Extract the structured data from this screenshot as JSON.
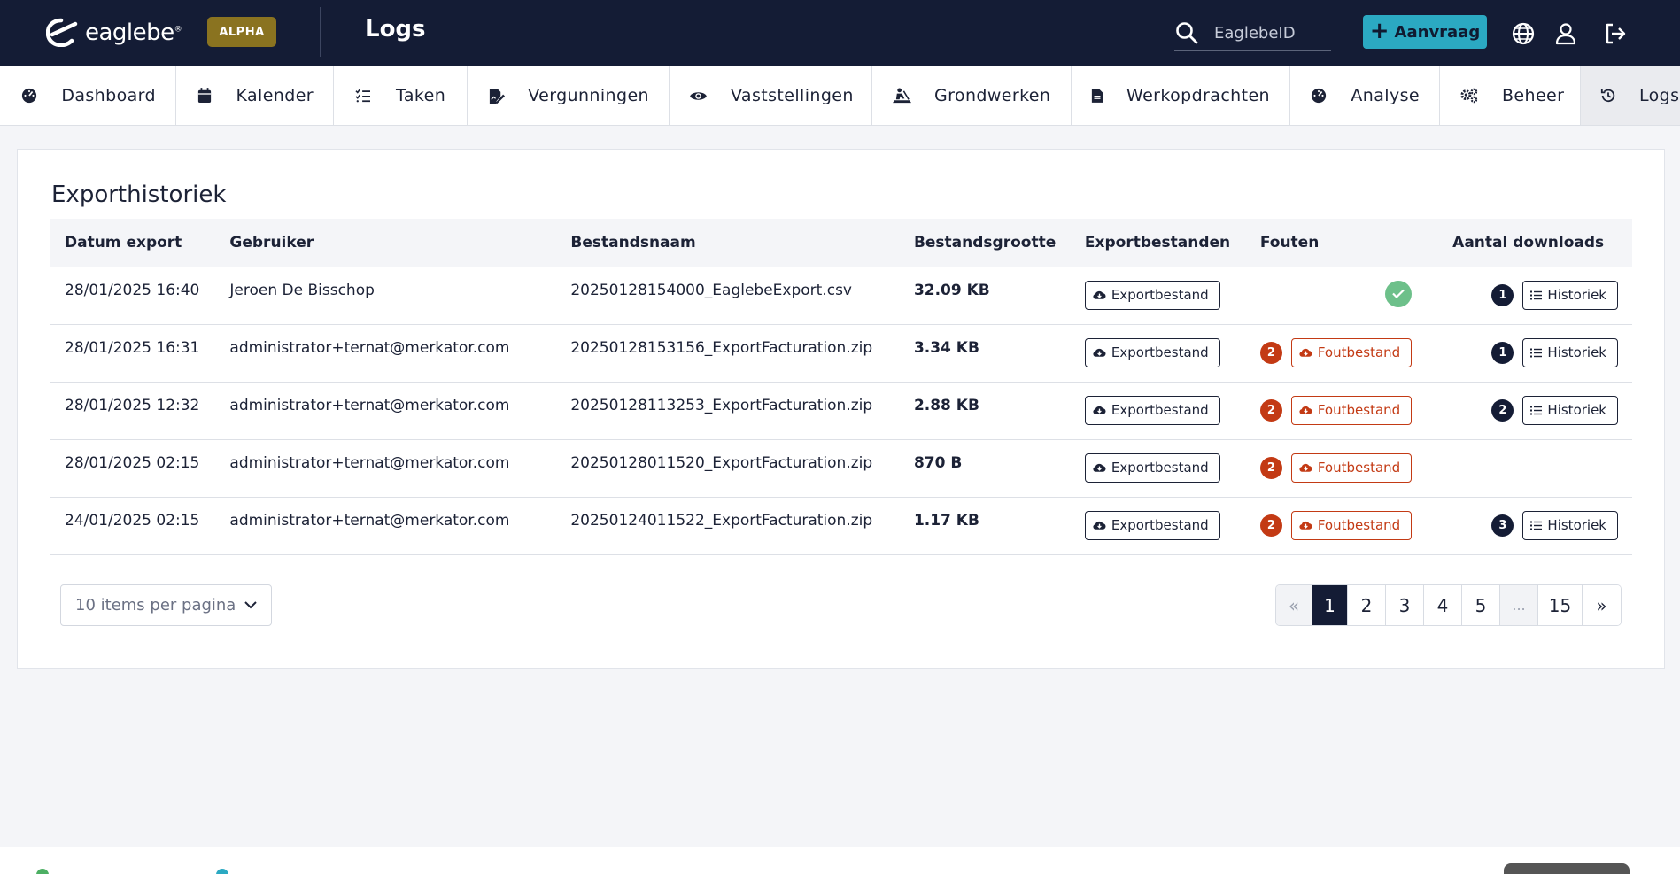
{
  "header": {
    "logo_text": "eaglebe",
    "logo_mark": "®",
    "alpha_badge": "ALPHA",
    "page_title": "Logs",
    "search_placeholder": "EaglebeID",
    "aanvraag_label": "Aanvraag",
    "icons": [
      "search-icon",
      "globe-icon",
      "user-icon",
      "logout-icon"
    ]
  },
  "nav": {
    "items": [
      {
        "label": "Dashboard",
        "icon": "dashboard-icon"
      },
      {
        "label": "Kalender",
        "icon": "calendar-icon"
      },
      {
        "label": "Taken",
        "icon": "tasks-icon"
      },
      {
        "label": "Vergunningen",
        "icon": "permit-icon"
      },
      {
        "label": "Vaststellingen",
        "icon": "eye-icon"
      },
      {
        "label": "Grondwerken",
        "icon": "digging-icon"
      },
      {
        "label": "Werkopdrachten",
        "icon": "document-icon"
      },
      {
        "label": "Analyse",
        "icon": "analysis-icon"
      },
      {
        "label": "Beheer",
        "icon": "gears-icon"
      },
      {
        "label": "Logs",
        "icon": "history-icon"
      }
    ],
    "active": "Logs"
  },
  "card": {
    "title": "Exporthistoriek",
    "columns": [
      "Datum export",
      "Gebruiker",
      "Bestandsnaam",
      "Bestandsgrootte",
      "Exportbestanden",
      "Fouten",
      "Aantal downloads"
    ],
    "export_button_label": "Exportbestand",
    "error_button_label": "Foutbestand",
    "history_button_label": "Historiek",
    "rows": [
      {
        "date": "28/01/2025 16:40",
        "user": "Jeroen De Bisschop",
        "file": "20250128154000_EaglebeExport.csv",
        "size": "32.09 KB",
        "errors": null,
        "downloads": "1"
      },
      {
        "date": "28/01/2025 16:31",
        "user": "administrator+ternat@merkator.com",
        "file": "20250128153156_ExportFacturation.zip",
        "size": "3.34 KB",
        "errors": "2",
        "downloads": "1"
      },
      {
        "date": "28/01/2025 12:32",
        "user": "administrator+ternat@merkator.com",
        "file": "20250128113253_ExportFacturation.zip",
        "size": "2.88 KB",
        "errors": "2",
        "downloads": "2"
      },
      {
        "date": "28/01/2025 02:15",
        "user": "administrator+ternat@merkator.com",
        "file": "20250128011520_ExportFacturation.zip",
        "size": "870 B",
        "errors": "2",
        "downloads": null
      },
      {
        "date": "24/01/2025 02:15",
        "user": "administrator+ternat@merkator.com",
        "file": "20250124011522_ExportFacturation.zip",
        "size": "1.17 KB",
        "errors": "2",
        "downloads": "3"
      }
    ],
    "per_page_label": "10 items per pagina",
    "pagination": {
      "prev": "«",
      "pages": [
        "1",
        "2",
        "3",
        "4",
        "5",
        "...",
        "15"
      ],
      "current": "1",
      "next": "»"
    }
  },
  "colors": {
    "topbar": "#141c35",
    "accent": "#2ba9c2",
    "alpha": "#8a7320",
    "error": "#c33a14",
    "success": "#6dc08a"
  }
}
